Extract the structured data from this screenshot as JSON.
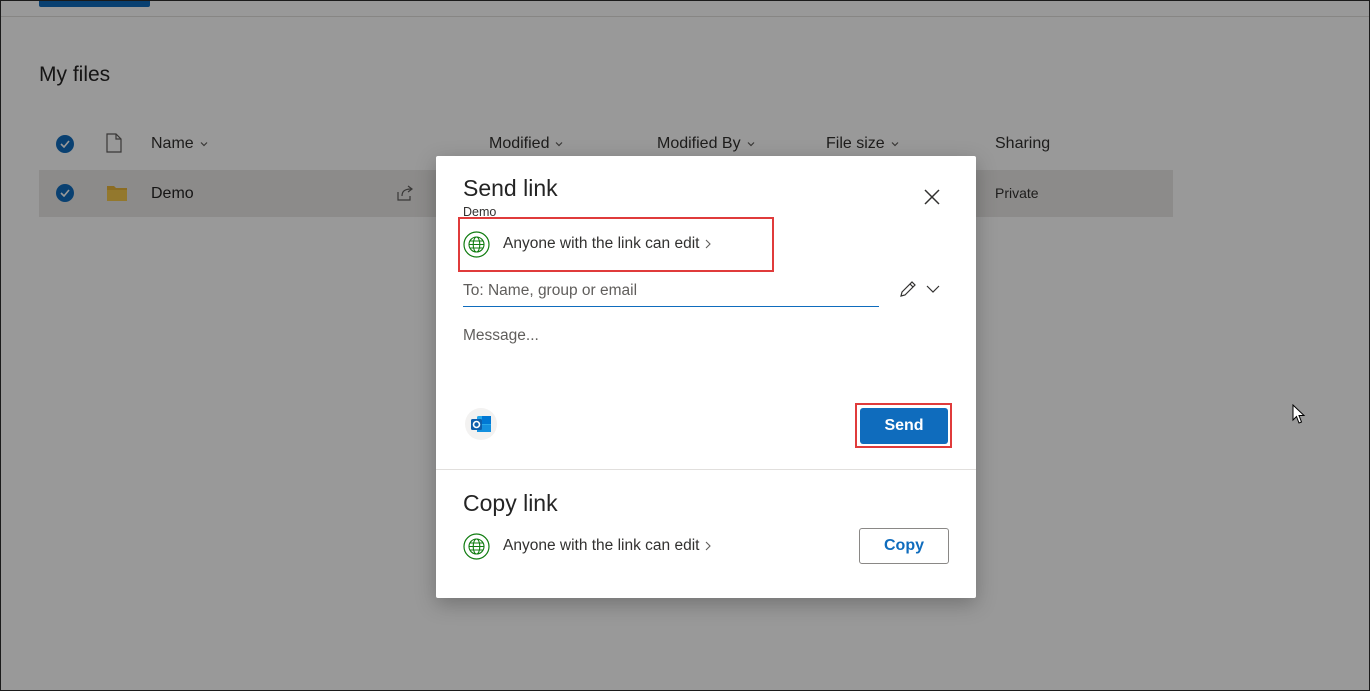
{
  "page": {
    "title": "My files",
    "columns": [
      {
        "label": "Name"
      },
      {
        "label": "Modified"
      },
      {
        "label": "Modified By"
      },
      {
        "label": "File size"
      },
      {
        "label": "Sharing"
      }
    ],
    "rows": [
      {
        "name": "Demo",
        "sharing": "Private",
        "icon": "folder-icon",
        "selected": true
      }
    ]
  },
  "dialog": {
    "title": "Send link",
    "subtitle": "Demo",
    "permission_label": "Anyone with the link can edit",
    "to_placeholder": "To: Name, group or email",
    "to_value": "",
    "message_placeholder": "Message...",
    "send_label": "Send",
    "copy_section_title": "Copy link",
    "copy_permission_label": "Anyone with the link can edit",
    "copy_label": "Copy"
  },
  "colors": {
    "accent": "#0f6cbd",
    "highlight": "#e03b3b",
    "globe": "#107c10",
    "folder": "#e8b43a"
  },
  "icons": [
    "checkbox-icon",
    "document-icon",
    "chevron-down-icon",
    "folder-icon",
    "share-icon",
    "globe-icon",
    "close-icon",
    "pencil-icon",
    "outlook-icon",
    "cursor-icon"
  ]
}
